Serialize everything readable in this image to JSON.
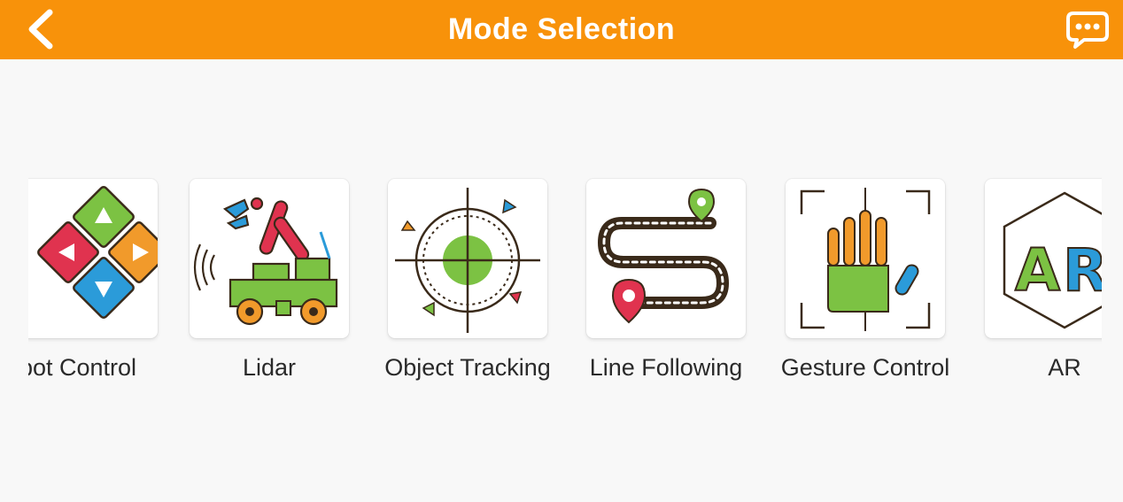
{
  "header": {
    "title": "Mode Selection",
    "back_icon": "chevron-left-icon",
    "chat_icon": "chat-bubble-icon",
    "color": "#f8920a"
  },
  "modes": [
    {
      "label": "bot Control",
      "icon": "dpad-icon"
    },
    {
      "label": "Lidar",
      "icon": "robot-arm-icon"
    },
    {
      "label": "Object Tracking",
      "icon": "target-icon"
    },
    {
      "label": "Line Following",
      "icon": "path-icon"
    },
    {
      "label": "Gesture Control",
      "icon": "hand-icon"
    },
    {
      "label": "AR",
      "icon": "ar-icon"
    }
  ]
}
